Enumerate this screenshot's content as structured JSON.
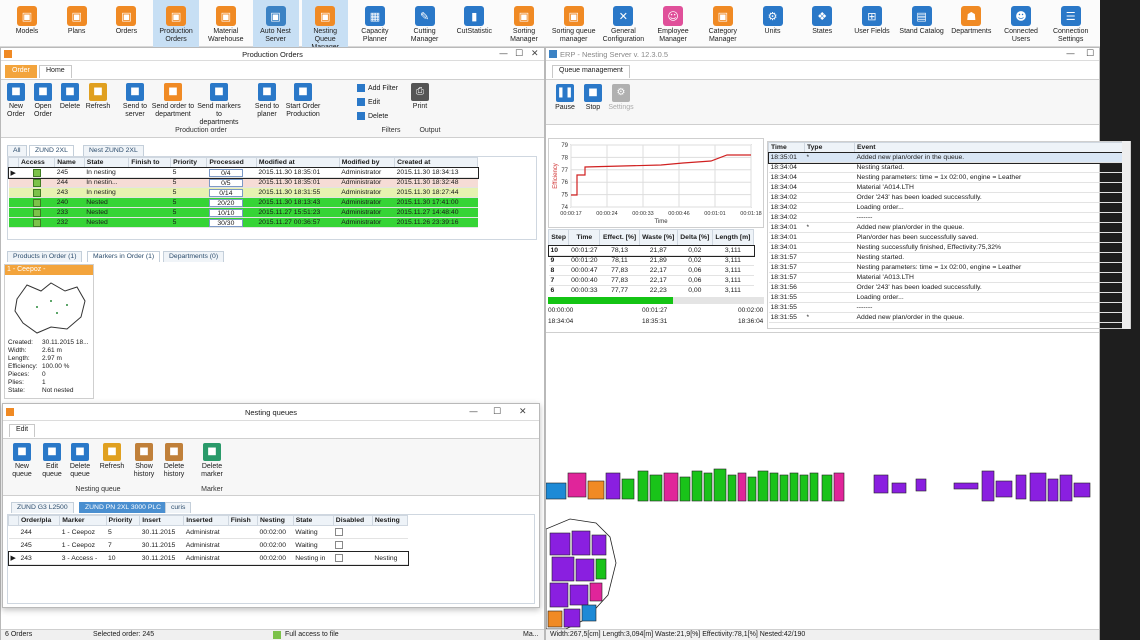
{
  "toolbar": {
    "items": [
      {
        "label": "Models",
        "icon": "cube-icon",
        "color": "#f08a24",
        "glyph": "▣",
        "active": false
      },
      {
        "label": "Plans",
        "icon": "cube-icon",
        "color": "#f08a24",
        "glyph": "▣",
        "active": false
      },
      {
        "label": "Orders",
        "icon": "cube-icon",
        "color": "#f08a24",
        "glyph": "▣",
        "active": false
      },
      {
        "label": "Production Orders",
        "icon": "cube-icon",
        "color": "#f08a24",
        "glyph": "▣",
        "active": true
      },
      {
        "label": "Material Warehouse",
        "icon": "cube-icon",
        "color": "#f08a24",
        "glyph": "▣",
        "active": false
      },
      {
        "label": "Auto Nest Server",
        "icon": "cube-icon",
        "color": "#3b82c4",
        "glyph": "▣",
        "active": true
      },
      {
        "label": "Nesting Queue Manager",
        "icon": "cube-icon",
        "color": "#f08a24",
        "glyph": "▣",
        "active": true
      },
      {
        "label": "Capacity Planner",
        "icon": "planner-icon",
        "color": "#2a78c8",
        "glyph": "▦",
        "active": false
      },
      {
        "label": "Cutting Manager",
        "icon": "knife-icon",
        "color": "#2a78c8",
        "glyph": "✎",
        "active": false
      },
      {
        "label": "CutStatistic",
        "icon": "bar-chart-icon",
        "color": "#2a78c8",
        "glyph": "▮",
        "active": false
      },
      {
        "label": "Sorting Manager",
        "icon": "cube-icon",
        "color": "#f08a24",
        "glyph": "▣",
        "active": false
      },
      {
        "label": "Sorting queue manager",
        "icon": "cube-icon",
        "color": "#f08a24",
        "glyph": "▣",
        "active": false
      },
      {
        "label": "General Configuration",
        "icon": "tools-icon",
        "color": "#2a78c8",
        "glyph": "✕",
        "active": false
      },
      {
        "label": "Employee Manager",
        "icon": "employee-icon",
        "color": "#e0509a",
        "glyph": "☺",
        "active": false
      },
      {
        "label": "Category Manager",
        "icon": "cube-icon",
        "color": "#f08a24",
        "glyph": "▣",
        "active": false
      },
      {
        "label": "Units",
        "icon": "gear-icon",
        "color": "#2a78c8",
        "glyph": "⚙",
        "active": false
      },
      {
        "label": "States",
        "icon": "states-icon",
        "color": "#2a78c8",
        "glyph": "❖",
        "active": false
      },
      {
        "label": "User Fields",
        "icon": "fields-icon",
        "color": "#2a78c8",
        "glyph": "⊞",
        "active": false
      },
      {
        "label": "Stand Catalog",
        "icon": "catalog-icon",
        "color": "#2a78c8",
        "glyph": "▤",
        "active": false
      },
      {
        "label": "Departments",
        "icon": "departments-icon",
        "color": "#f08a24",
        "glyph": "☗",
        "active": false
      },
      {
        "label": "Connected Users",
        "icon": "users-icon",
        "color": "#2a78c8",
        "glyph": "☻",
        "active": false
      },
      {
        "label": "Connection Settings",
        "icon": "database-icon",
        "color": "#2a78c8",
        "glyph": "☰",
        "active": false
      }
    ]
  },
  "production_orders": {
    "title": "Production Orders",
    "ribbon_tabs": [
      "Order",
      "Home"
    ],
    "buttons": [
      {
        "label": "New Order",
        "icon": "new-order-icon",
        "color": "#2a78c8"
      },
      {
        "label": "Open Order",
        "icon": "open-order-icon",
        "color": "#2a78c8"
      },
      {
        "label": "Delete",
        "icon": "delete-icon",
        "color": "#2a78c8"
      },
      {
        "label": "Refresh",
        "icon": "refresh-icon",
        "color": "#e0a020"
      },
      {
        "label": "Send to server",
        "icon": "send-server-icon",
        "color": "#2a78c8"
      },
      {
        "label": "Send order to department",
        "icon": "send-department-icon",
        "color": "#f08a24"
      },
      {
        "label": "Send markers to departments",
        "icon": "send-markers-icon",
        "color": "#2a78c8"
      },
      {
        "label": "Send to planer",
        "icon": "send-planer-icon",
        "color": "#2a78c8"
      },
      {
        "label": "Start Order Production",
        "icon": "start-production-icon",
        "color": "#2a78c8"
      }
    ],
    "filters": [
      "Add Filter",
      "Edit",
      "Delete"
    ],
    "print_label": "Print",
    "groups": [
      "Production order",
      "Filters",
      "Output"
    ],
    "sub_tabs": [
      "All",
      "ZUND 2XL",
      "Nest ZUND 2XL"
    ],
    "columns": [
      "Access",
      "Name",
      "State",
      "Finish to",
      "Priority",
      "Processed",
      "Modified at",
      "Modified by",
      "Created at"
    ],
    "rows": [
      {
        "name": "245",
        "state": "In nesting",
        "finish": "",
        "priority": "5",
        "processed": "0/4",
        "modified": "2015.11.30 18:35:01",
        "by": "Administrator",
        "created": "2015.11.30 18:34:13",
        "bg": "#ffffff",
        "sel": true
      },
      {
        "name": "244",
        "state": "In nestin...",
        "finish": "",
        "priority": "5",
        "processed": "0/5",
        "modified": "2015.11.30 18:35:01",
        "by": "Administrator",
        "created": "2015.11.30 18:32:48",
        "bg": "#f6dcd6",
        "sel": false
      },
      {
        "name": "243",
        "state": "In nesting",
        "finish": "",
        "priority": "5",
        "processed": "0/14",
        "modified": "2015.11.30 18:31:55",
        "by": "Administrator",
        "created": "2015.11.30 18:27:44",
        "bg": "#e6f2b0",
        "sel": false
      },
      {
        "name": "240",
        "state": "Nested",
        "finish": "",
        "priority": "5",
        "processed": "20/20",
        "modified": "2015.11.30 18:13:43",
        "by": "Administrator",
        "created": "2015.11.30 17:41:00",
        "bg": "#36d436",
        "sel": false
      },
      {
        "name": "233",
        "state": "Nested",
        "finish": "",
        "priority": "5",
        "processed": "10/10",
        "modified": "2015.11.27 15:51:23",
        "by": "Administrator",
        "created": "2015.11.27 14:48:40",
        "bg": "#36d436",
        "sel": false
      },
      {
        "name": "232",
        "state": "Nested",
        "finish": "",
        "priority": "5",
        "processed": "30/30",
        "modified": "2015.11.27 00:36:57",
        "by": "Administrator",
        "created": "2015.11.26 23:39:16",
        "bg": "#36d436",
        "sel": false
      }
    ],
    "bottom_tabs": [
      "Products in Order (1)",
      "Markers in Order (1)",
      "Departments (0)"
    ],
    "marker": {
      "title": "1 - Ceepoz -",
      "fields": [
        {
          "k": "Created:",
          "v": "30.11.2015 18..."
        },
        {
          "k": "Width:",
          "v": "2.61 m"
        },
        {
          "k": "Length:",
          "v": "2.97 m"
        },
        {
          "k": "Efficiency:",
          "v": "100.00 %"
        },
        {
          "k": "Pieces:",
          "v": "0"
        },
        {
          "k": "Plies:",
          "v": "1"
        },
        {
          "k": "State:",
          "v": "Not nested"
        }
      ]
    },
    "status": {
      "count": "6 Orders",
      "selected": "Selected order: 245",
      "access": "Full access to file",
      "right": "Ma..."
    }
  },
  "nesting_queues": {
    "title": "Nesting queues",
    "tab": "Edit",
    "buttons": [
      {
        "label": "New queue",
        "icon": "new-queue-icon",
        "color": "#2a78c8"
      },
      {
        "label": "Edit queue",
        "icon": "edit-queue-icon",
        "color": "#2a78c8"
      },
      {
        "label": "Delete queue",
        "icon": "delete-queue-icon",
        "color": "#2a78c8"
      },
      {
        "label": "Refresh",
        "icon": "refresh-icon",
        "color": "#e0a020"
      },
      {
        "label": "Show history",
        "icon": "hourglass-icon",
        "color": "#c0803a"
      },
      {
        "label": "Delete history",
        "icon": "delete-history-icon",
        "color": "#c0803a"
      },
      {
        "label": "Delete marker",
        "icon": "delete-marker-icon",
        "color": "#2a9a6a"
      }
    ],
    "groups": [
      "Nesting queue",
      "Marker"
    ],
    "queue_tabs": [
      "ZUND G3 L2500",
      "ZUND PN 2XL 3000 PLC",
      "curis"
    ],
    "columns": [
      "Order/pla",
      "Marker",
      "Priority",
      "Insert",
      "Inserted",
      "Finish",
      "Nesting",
      "State",
      "Disabled",
      "Nesting"
    ],
    "rows": [
      {
        "order": "244",
        "marker": "1 - Ceepoz",
        "priority": "5",
        "insert": "30.11.2015",
        "inserted": "Administrat",
        "finish": "",
        "nesting": "00:02:00",
        "state": "Waiting",
        "nesting2": "",
        "sel": false
      },
      {
        "order": "245",
        "marker": "1 - Ceepoz",
        "priority": "7",
        "insert": "30.11.2015",
        "inserted": "Administrat",
        "finish": "",
        "nesting": "00:02:00",
        "state": "Waiting",
        "nesting2": "",
        "sel": false
      },
      {
        "order": "243",
        "marker": "3 - Access -",
        "priority": "10",
        "insert": "30.11.2015",
        "inserted": "Administrat",
        "finish": "",
        "nesting": "00:02:00",
        "state": "Nesting in",
        "nesting2": "Nesting",
        "sel": true
      }
    ]
  },
  "nesting_server": {
    "title": "ERP - Nesting Server v. 12.3.0.5",
    "tab": "Queue management",
    "buttons": [
      {
        "label": "Pause",
        "icon": "pause-icon",
        "color": "#2a78c8"
      },
      {
        "label": "Stop",
        "icon": "stop-icon",
        "color": "#2a78c8"
      },
      {
        "label": "Settings",
        "icon": "gear-icon",
        "color": "#b0b0b0"
      }
    ],
    "chart": {
      "ylabel": "Efficiency",
      "xlabel": "Time",
      "yticks": [
        "79",
        "78",
        "77",
        "76",
        "75",
        "74"
      ],
      "xticks": [
        "00:00:17",
        "00:00:24",
        "00:00:33",
        "00:00:46",
        "00:01:01",
        "00:01:18"
      ]
    },
    "steps_columns": [
      "Step",
      "Time",
      "Effect. [%]",
      "Waste [%]",
      "Delta [%]",
      "Length [m]"
    ],
    "steps": [
      {
        "step": "10",
        "time": "00:01:27",
        "eff": "78,13",
        "waste": "21,87",
        "delta": "0,02",
        "len": "3,111",
        "sel": true
      },
      {
        "step": "9",
        "time": "00:01:20",
        "eff": "78,11",
        "waste": "21,89",
        "delta": "0,02",
        "len": "3,111",
        "sel": false
      },
      {
        "step": "8",
        "time": "00:00:47",
        "eff": "77,83",
        "waste": "22,17",
        "delta": "0,06",
        "len": "3,111",
        "sel": false
      },
      {
        "step": "7",
        "time": "00:00:40",
        "eff": "77,83",
        "waste": "22,17",
        "delta": "0,06",
        "len": "3,111",
        "sel": false
      },
      {
        "step": "6",
        "time": "00:00:33",
        "eff": "77,77",
        "waste": "22,23",
        "delta": "0,00",
        "len": "3,111",
        "sel": false
      }
    ],
    "progress": 0.58,
    "timer": {
      "left_top": "00:00:00",
      "mid_top": "00:01:27",
      "right_top": "00:02:00",
      "left_bot": "18:34:04",
      "mid_bot": "18:35:31",
      "right_bot": "18:36:04"
    },
    "log_columns": [
      "Time",
      "Type",
      "Event"
    ],
    "log": [
      {
        "time": "18:35:01",
        "type": "*",
        "event": "Added new plan/order in the queue.",
        "sel": true
      },
      {
        "time": "18:34:04",
        "type": "",
        "event": "Nesting started.",
        "sel": false
      },
      {
        "time": "18:34:04",
        "type": "",
        "event": "Nesting parameters: time = 1x 02:00, engine = Leather",
        "sel": false
      },
      {
        "time": "18:34:04",
        "type": "",
        "event": "Material 'A014.LTH",
        "sel": false
      },
      {
        "time": "18:34:02",
        "type": "",
        "event": "Order '243' has been loaded successfully.",
        "sel": false
      },
      {
        "time": "18:34:02",
        "type": "",
        "event": "Loading order...",
        "sel": false
      },
      {
        "time": "18:34:02",
        "type": "",
        "event": "-------",
        "sel": false
      },
      {
        "time": "18:34:01",
        "type": "*",
        "event": "Added new plan/order in the queue.",
        "sel": false
      },
      {
        "time": "18:34:01",
        "type": "",
        "event": "Plan/order has been successfully saved.",
        "sel": false
      },
      {
        "time": "18:34:01",
        "type": "",
        "event": "Nesting successfully finished, Effectivity:75,32%",
        "sel": false
      },
      {
        "time": "18:31:57",
        "type": "",
        "event": "Nesting started.",
        "sel": false
      },
      {
        "time": "18:31:57",
        "type": "",
        "event": "Nesting parameters: time = 1x 02:00, engine = Leather",
        "sel": false
      },
      {
        "time": "18:31:57",
        "type": "",
        "event": "Material 'A013.LTH",
        "sel": false
      },
      {
        "time": "18:31:56",
        "type": "",
        "event": "Order '243' has been loaded successfully.",
        "sel": false
      },
      {
        "time": "18:31:55",
        "type": "",
        "event": "Loading order...",
        "sel": false
      },
      {
        "time": "18:31:55",
        "type": "",
        "event": "-------",
        "sel": false
      },
      {
        "time": "18:31:55",
        "type": "*",
        "event": "Added new plan/order in the queue.",
        "sel": false
      }
    ],
    "status": "Width:267,5[cm]  Length:3,094[m]  Waste:21,9[%]  Effectivity:78,1[%]  Nested:42/190"
  }
}
